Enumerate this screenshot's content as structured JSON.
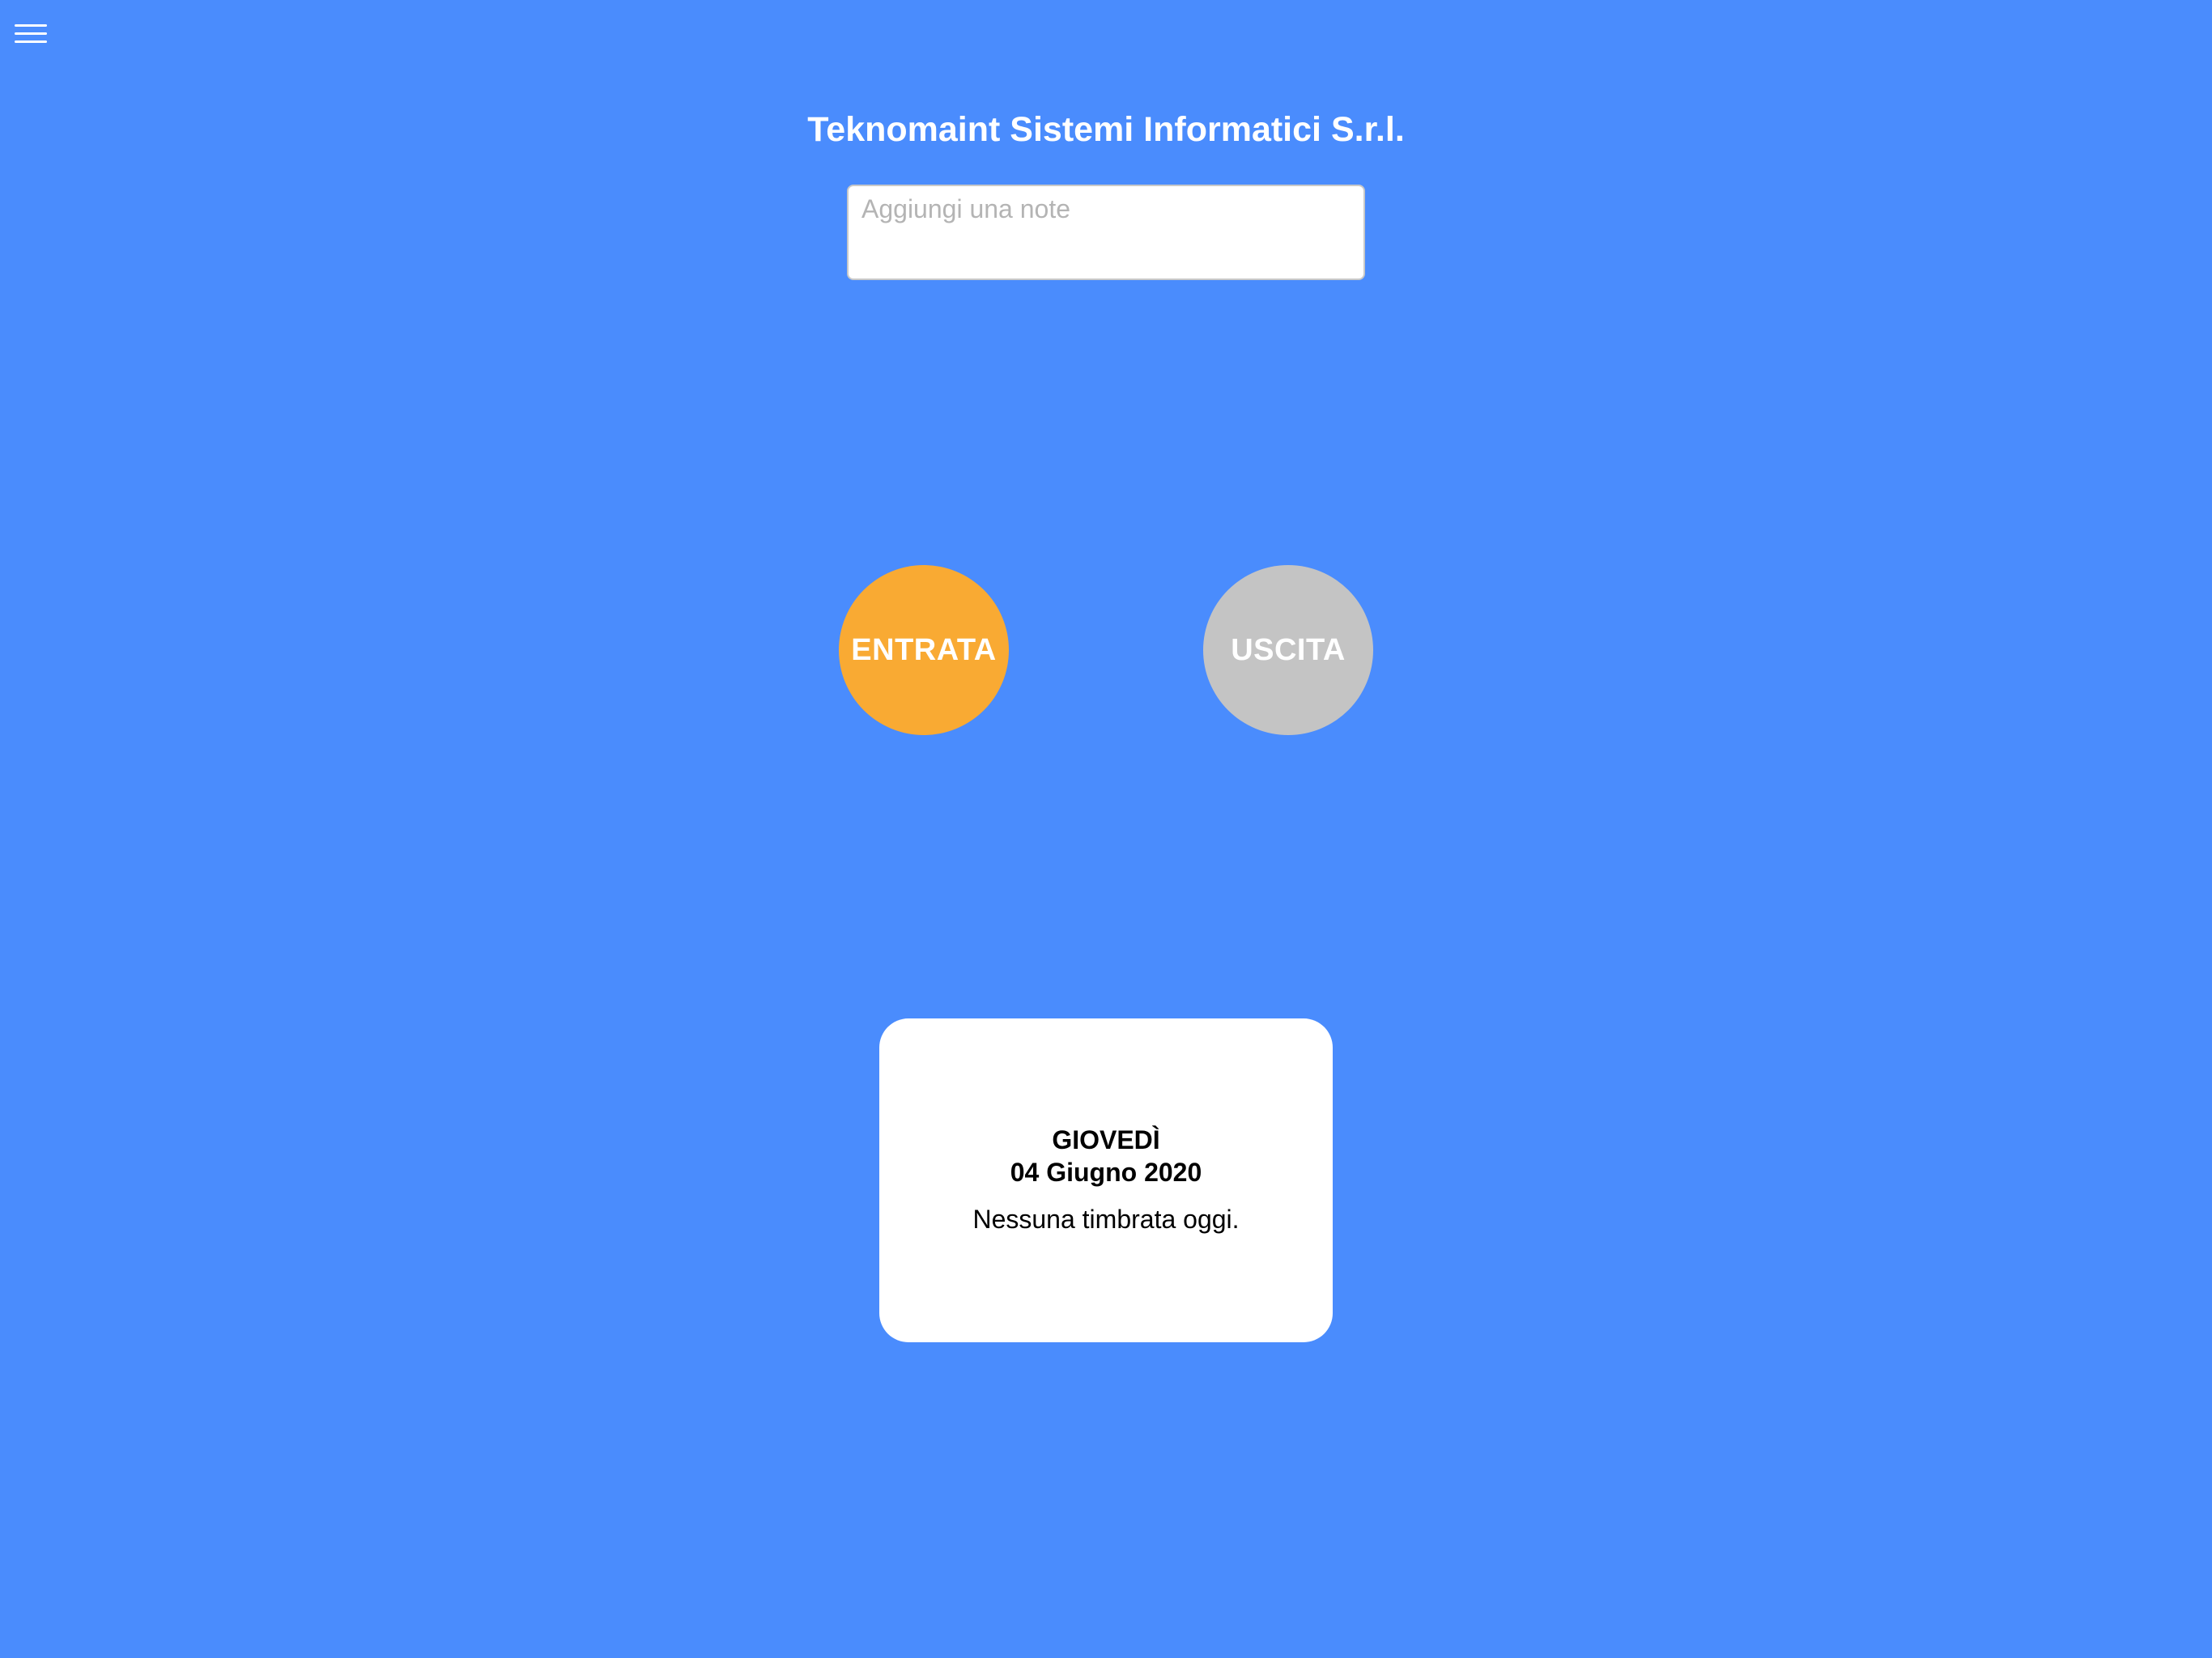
{
  "colors": {
    "background": "#4a8cfd",
    "entrata_button": "#f9aa33",
    "uscita_button": "#c4c4c4",
    "card": "#ffffff",
    "title_text": "#ffffff"
  },
  "header": {
    "menu_icon": "hamburger-menu-icon",
    "company_name": "Teknomaint Sistemi Informatici S.r.l."
  },
  "note": {
    "placeholder": "Aggiungi una note",
    "value": ""
  },
  "actions": {
    "entrata_label": "ENTRATA",
    "uscita_label": "USCITA"
  },
  "day_summary": {
    "weekday": "GIOVEDÌ",
    "date": "04 Giugno 2020",
    "status": "Nessuna timbrata oggi."
  }
}
